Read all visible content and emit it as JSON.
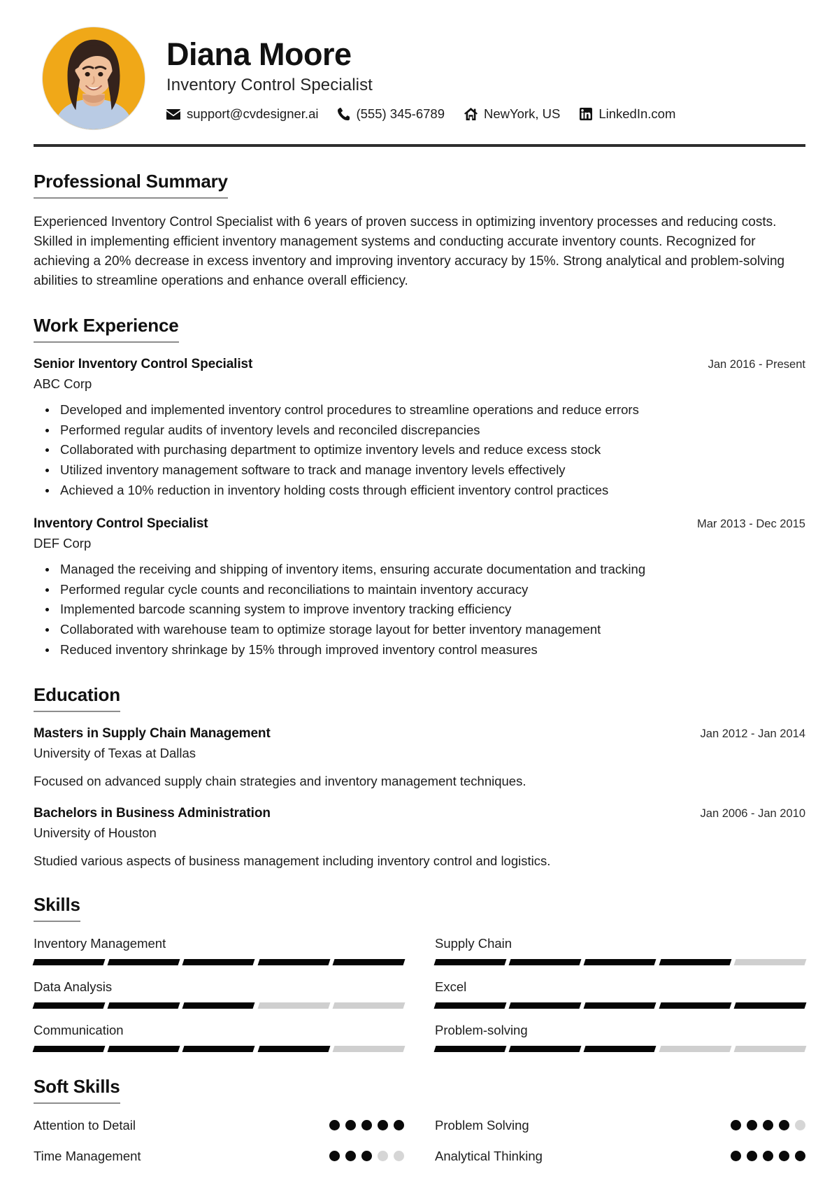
{
  "header": {
    "name": "Diana Moore",
    "job_title": "Inventory Control Specialist",
    "avatar_alt": "profile-photo",
    "contacts": [
      {
        "icon": "envelope-icon",
        "value": "support@cvdesigner.ai"
      },
      {
        "icon": "phone-icon",
        "value": "(555) 345-6789"
      },
      {
        "icon": "home-icon",
        "value": "NewYork, US"
      },
      {
        "icon": "linkedin-icon",
        "value": "LinkedIn.com"
      }
    ]
  },
  "summary": {
    "title": "Professional Summary",
    "text": "Experienced Inventory Control Specialist with 6 years of proven success in optimizing inventory processes and reducing costs. Skilled in implementing efficient inventory management systems and conducting accurate inventory counts. Recognized for achieving a 20% decrease in excess inventory and improving inventory accuracy by 15%. Strong analytical and problem-solving abilities to streamline operations and enhance overall efficiency."
  },
  "work_experience": {
    "title": "Work Experience",
    "entries": [
      {
        "role": "Senior Inventory Control Specialist",
        "organization": "ABC Corp",
        "date": "Jan 2016 - Present",
        "bullets": [
          "Developed and implemented inventory control procedures to streamline operations and reduce errors",
          "Performed regular audits of inventory levels and reconciled discrepancies",
          "Collaborated with purchasing department to optimize inventory levels and reduce excess stock",
          "Utilized inventory management software to track and manage inventory levels effectively",
          "Achieved a 10% reduction in inventory holding costs through efficient inventory control practices"
        ]
      },
      {
        "role": "Inventory Control Specialist",
        "organization": "DEF Corp",
        "date": "Mar 2013 - Dec 2015",
        "bullets": [
          "Managed the receiving and shipping of inventory items, ensuring accurate documentation and tracking",
          "Performed regular cycle counts and reconciliations to maintain inventory accuracy",
          "Implemented barcode scanning system to improve inventory tracking efficiency",
          "Collaborated with warehouse team to optimize storage layout for better inventory management",
          "Reduced inventory shrinkage by 15% through improved inventory control measures"
        ]
      }
    ]
  },
  "education": {
    "title": "Education",
    "entries": [
      {
        "degree": "Masters in Supply Chain Management",
        "school": "University of Texas at Dallas",
        "date": "Jan 2012 - Jan 2014",
        "description": "Focused on advanced supply chain strategies and inventory management techniques."
      },
      {
        "degree": "Bachelors in Business Administration",
        "school": "University of Houston",
        "date": "Jan 2006 - Jan 2010",
        "description": "Studied various aspects of business management including inventory control and logistics."
      }
    ]
  },
  "skills": {
    "title": "Skills",
    "max_level": 5,
    "items": [
      {
        "label": "Inventory Management",
        "level": 5
      },
      {
        "label": "Supply Chain",
        "level": 4
      },
      {
        "label": "Data Analysis",
        "level": 3
      },
      {
        "label": "Excel",
        "level": 5
      },
      {
        "label": "Communication",
        "level": 4
      },
      {
        "label": "Problem-solving",
        "level": 3
      }
    ]
  },
  "soft_skills": {
    "title": "Soft Skills",
    "max_level": 5,
    "items": [
      {
        "label": "Attention to Detail",
        "level": 5
      },
      {
        "label": "Problem Solving",
        "level": 4
      },
      {
        "label": "Time Management",
        "level": 3
      },
      {
        "label": "Analytical Thinking",
        "level": 5
      }
    ]
  },
  "colors": {
    "text": "#1d1d1d",
    "heading": "#111111",
    "rule": "#2e2e2e",
    "underline": "#8d8d8d",
    "filled": "#060606",
    "empty": "#cfcfcf",
    "avatar_bg": "#f0a818"
  }
}
